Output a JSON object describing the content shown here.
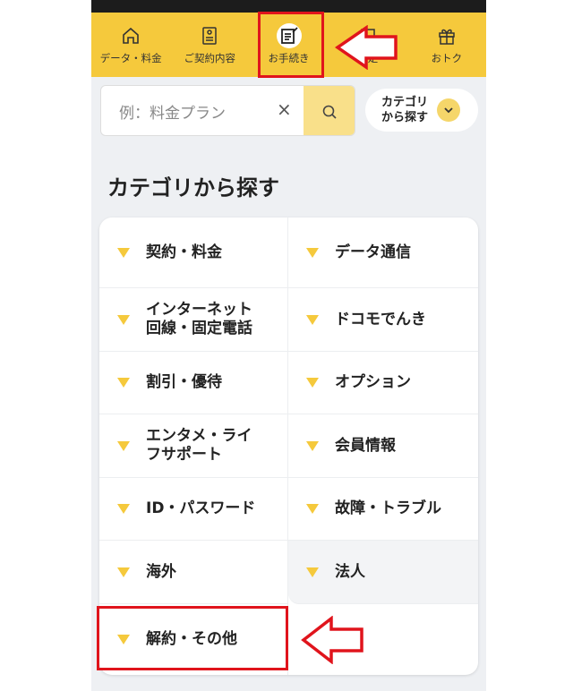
{
  "nav": {
    "items": [
      {
        "label": "データ・料金",
        "icon": "home-icon"
      },
      {
        "label": "ご契約内容",
        "icon": "contract-icon"
      },
      {
        "label": "お手続き",
        "icon": "procedure-icon",
        "active": true
      },
      {
        "label": "設定",
        "icon": "settings-icon"
      },
      {
        "label": "おトク",
        "icon": "gift-icon"
      }
    ]
  },
  "search": {
    "placeholder": "例：料金プラン",
    "clear": "×"
  },
  "category_button": {
    "line1": "カテゴリ",
    "line2": "から探す"
  },
  "section_title": "カテゴリから探す",
  "categories": [
    {
      "line1": "契約・料金",
      "line2": ""
    },
    {
      "line1": "データ通信",
      "line2": ""
    },
    {
      "line1": "インターネット",
      "line2": "回線・固定電話"
    },
    {
      "line1": "ドコモでんき",
      "line2": ""
    },
    {
      "line1": "割引・優待",
      "line2": ""
    },
    {
      "line1": "オプション",
      "line2": ""
    },
    {
      "line1": "エンタメ・ライ",
      "line2": "フサポート"
    },
    {
      "line1": "会員情報",
      "line2": ""
    },
    {
      "line1": "ID・パスワード",
      "line2": ""
    },
    {
      "line1": "故障・トラブル",
      "line2": ""
    },
    {
      "line1": "海外",
      "line2": ""
    },
    {
      "line1": "法人",
      "line2": ""
    },
    {
      "line1": "解約・その他",
      "line2": ""
    }
  ],
  "colors": {
    "brand_yellow": "#f5c93c",
    "annotation_red": "#e0141c"
  }
}
